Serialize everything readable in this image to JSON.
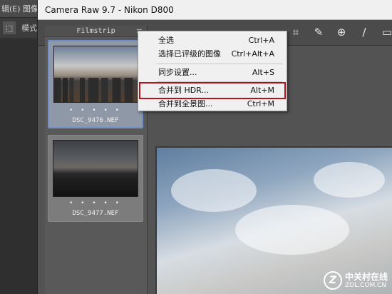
{
  "ps": {
    "menu_label": "辑(E) 图像",
    "toolbar_icon": "⬚",
    "toolbar_label": "模式"
  },
  "camera_raw": {
    "title": "Camera Raw 9.7 -  Nikon D800",
    "tool_icons": [
      "crop-icon",
      "spot-removal-icon",
      "red-eye-icon",
      "adjustment-brush-icon",
      "graduated-filter-icon"
    ],
    "filmstrip": {
      "header": "Filmstrip",
      "menu_icon": "≡",
      "items": [
        {
          "file": "DSC_9476.NEF",
          "rating": "• • • • •",
          "selected": true
        },
        {
          "file": "DSC_9477.NEF",
          "rating": "• • • • •",
          "selected": false
        }
      ]
    }
  },
  "context_menu": {
    "items": [
      {
        "label": "全选",
        "shortcut": "Ctrl+A"
      },
      {
        "label": "选择已评级的图像",
        "shortcut": "Ctrl+Alt+A"
      },
      {
        "label": "同步设置...",
        "shortcut": "Alt+S"
      },
      {
        "label": "合并到 HDR...",
        "shortcut": "Alt+M",
        "highlighted": true
      },
      {
        "label": "合并到全景图...",
        "shortcut": "Ctrl+M"
      }
    ],
    "highlight_color": "#b5121b"
  },
  "watermark": {
    "logo": "Z",
    "name_cn": "中关村在线",
    "url": "ZOL.COM.CN"
  }
}
